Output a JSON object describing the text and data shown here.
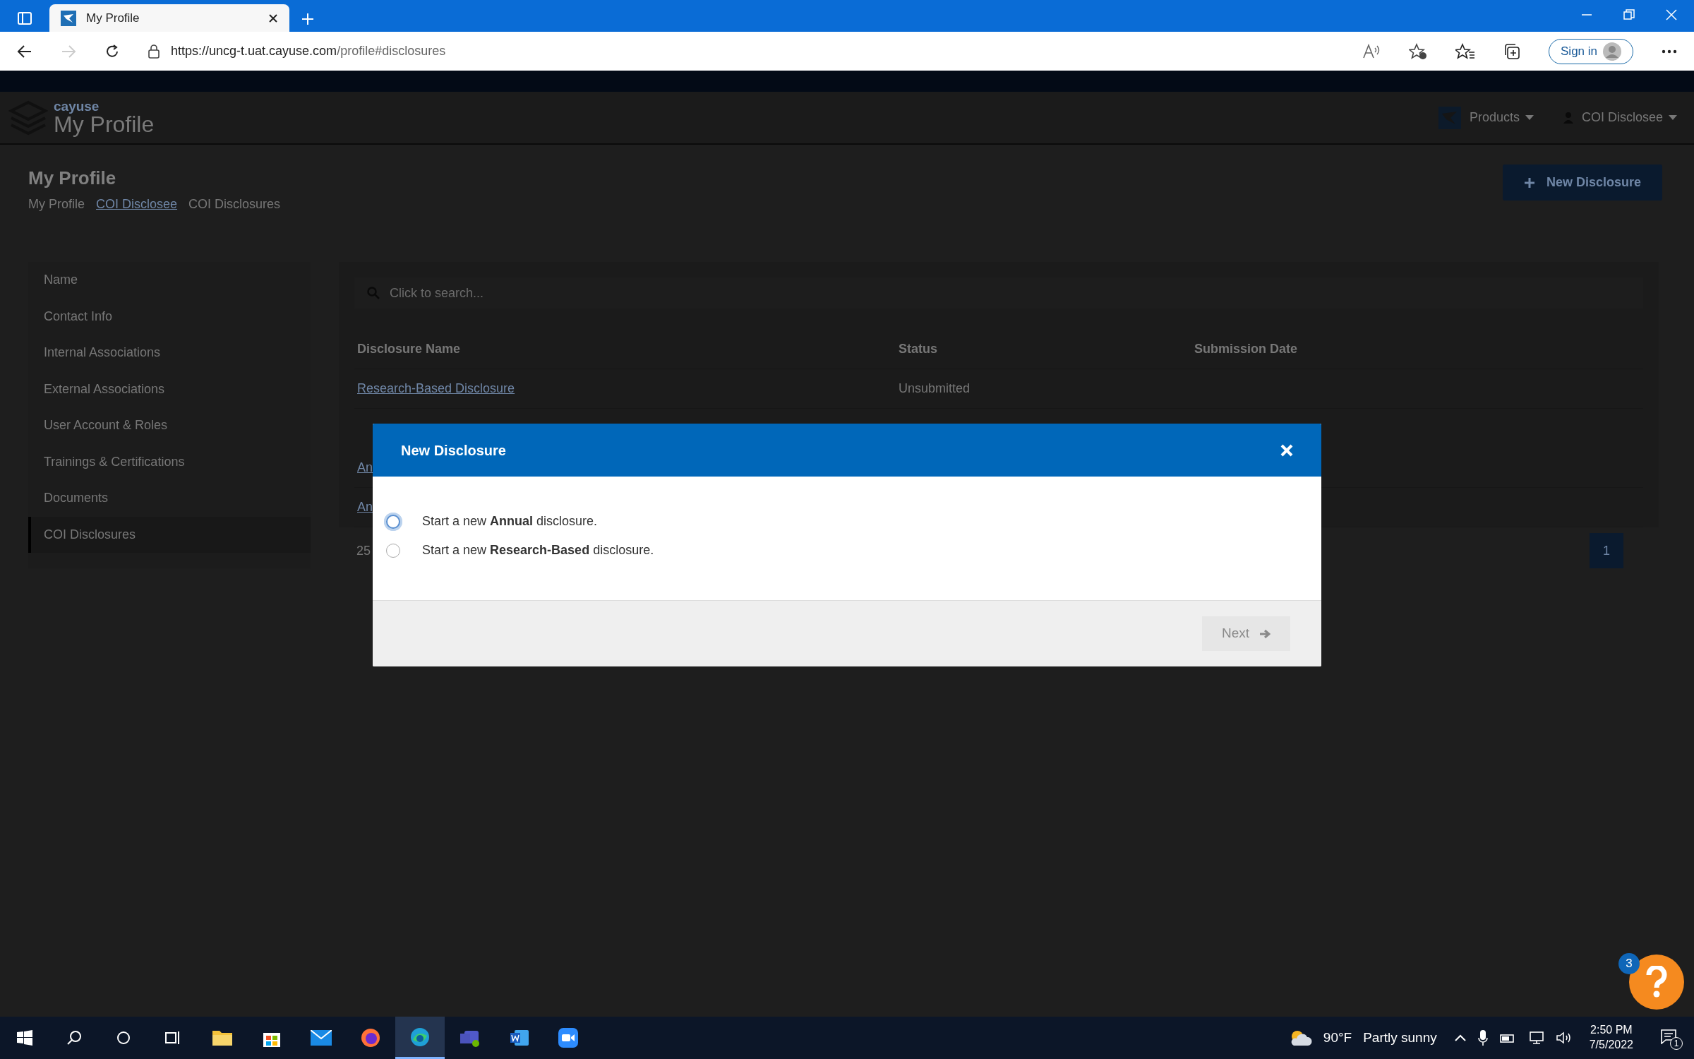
{
  "browser": {
    "tab_title": "My Profile",
    "url_host": "https://uncg-t.uat.cayuse.com",
    "url_path": "/profile#disclosures",
    "sign_in": "Sign in"
  },
  "app": {
    "brand": "cayuse",
    "title": "My Profile",
    "products": "Products",
    "user": "COI Disclosee"
  },
  "page": {
    "title": "My Profile",
    "breadcrumbs": [
      {
        "label": "My Profile",
        "link": false
      },
      {
        "label": "COI Disclosee",
        "link": true
      },
      {
        "label": "COI Disclosures",
        "link": false
      }
    ],
    "new_button": "New Disclosure"
  },
  "sidebar": {
    "items": [
      {
        "label": "Name",
        "selected": false
      },
      {
        "label": "Contact Info",
        "selected": false
      },
      {
        "label": "Internal Associations",
        "selected": false
      },
      {
        "label": "External Associations",
        "selected": false
      },
      {
        "label": "User Account & Roles",
        "selected": false
      },
      {
        "label": "Trainings & Certifications",
        "selected": false
      },
      {
        "label": "Documents",
        "selected": false
      },
      {
        "label": "COI Disclosures",
        "selected": true
      }
    ]
  },
  "search": {
    "placeholder": "Click to search..."
  },
  "table": {
    "columns": [
      "Disclosure Name",
      "Status",
      "Submission Date"
    ],
    "rows": [
      {
        "name": "Research-Based Disclosure",
        "status": "Unsubmitted"
      },
      {
        "name": "An"
      },
      {
        "name": "An"
      }
    ]
  },
  "pagination": {
    "page_size": "25",
    "pages": [
      {
        "label": "1",
        "selected": true
      }
    ]
  },
  "modal": {
    "title": "New Disclosure",
    "options": [
      {
        "text": "Start a new **Annual** disclosure.",
        "selected": false,
        "focused": true
      },
      {
        "text": "Start a new **Research-Based** disclosure.",
        "selected": false,
        "focused": false
      }
    ],
    "next": {
      "label": "Next",
      "disabled": true
    }
  },
  "help": {
    "badge": "3"
  },
  "taskbar": {
    "temperature": "90°F",
    "weather": "Partly sunny",
    "time": "2:50 PM",
    "date": "7/5/2022",
    "notifications": "1"
  }
}
